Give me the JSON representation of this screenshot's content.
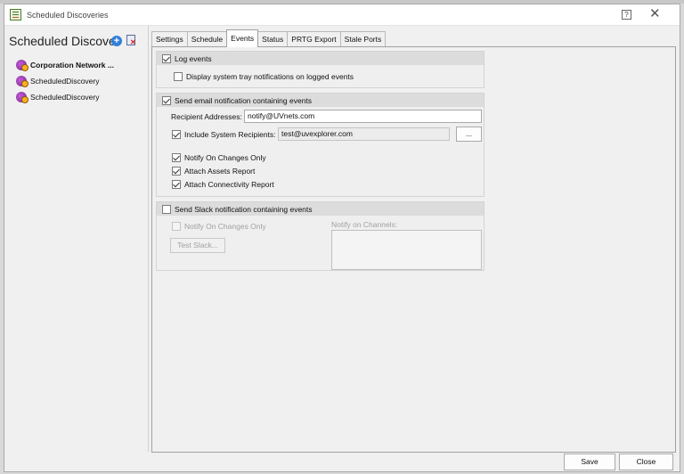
{
  "window": {
    "title": "Scheduled Discoveries",
    "help_glyph": "?",
    "close_glyph": "✕"
  },
  "sidebar": {
    "title": "Scheduled Discoveries",
    "items": [
      {
        "label": "Corporation Network ...",
        "bold": true
      },
      {
        "label": "ScheduledDiscovery",
        "bold": false
      },
      {
        "label": "ScheduledDiscovery",
        "bold": false
      }
    ]
  },
  "tabs": [
    {
      "label": "Settings",
      "active": false
    },
    {
      "label": "Schedule",
      "active": false
    },
    {
      "label": "Events",
      "active": true
    },
    {
      "label": "Status",
      "active": false
    },
    {
      "label": "PRTG Export",
      "active": false
    },
    {
      "label": "Stale Ports",
      "active": false
    }
  ],
  "events": {
    "log_group": {
      "header": "Log events",
      "header_checked": true,
      "tray_label": "Display system tray notifications on logged events",
      "tray_checked": false
    },
    "email_group": {
      "header": "Send email notification containing events",
      "header_checked": true,
      "recipient_label": "Recipient Addresses:",
      "recipient_value": "notify@UVnets.com",
      "include_label": "Include System Recipients:",
      "include_checked": true,
      "system_recipient_value": "test@uvexplorer.com",
      "browse_label": "...",
      "notify_changes_label": "Notify On Changes Only",
      "notify_changes_checked": true,
      "assets_label": "Attach Assets Report",
      "assets_checked": true,
      "connectivity_label": "Attach Connectivity Report",
      "connectivity_checked": true
    },
    "slack_group": {
      "header": "Send Slack notification containing events",
      "header_checked": false,
      "notify_changes_label": "Notify On Changes Only",
      "test_label": "Test Slack...",
      "channels_label": "Notify on Channels:"
    }
  },
  "footer": {
    "save_label": "Save",
    "close_label": "Close"
  }
}
